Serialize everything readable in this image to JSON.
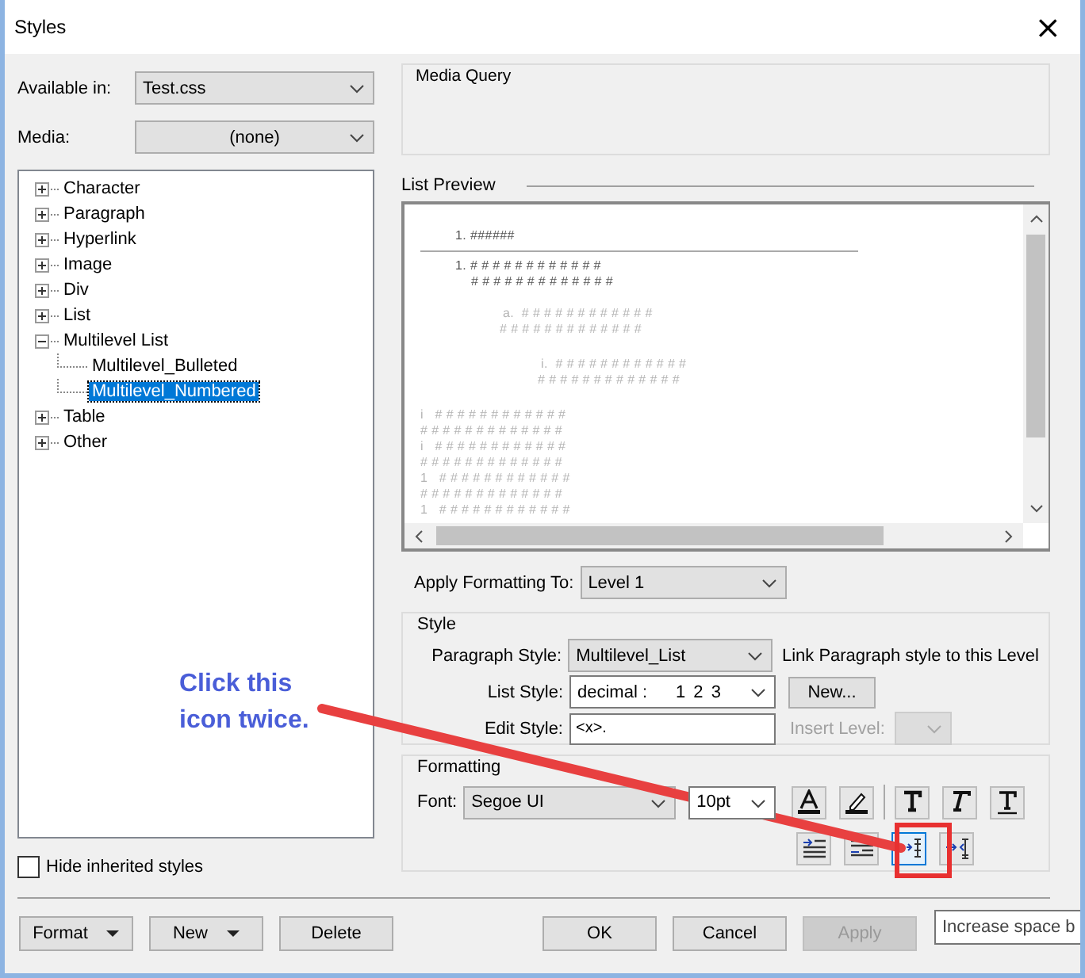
{
  "window": {
    "title": "Styles",
    "close": "×"
  },
  "available_in": {
    "label": "Available in:",
    "value": "Test.css"
  },
  "media": {
    "label": "Media:",
    "value": "(none)"
  },
  "tree": [
    {
      "label": "Character",
      "expanded": false,
      "selected": false
    },
    {
      "label": "Paragraph",
      "expanded": false,
      "selected": false
    },
    {
      "label": "Hyperlink",
      "expanded": false,
      "selected": false
    },
    {
      "label": "Image",
      "expanded": false,
      "selected": false
    },
    {
      "label": "Div",
      "expanded": false,
      "selected": false
    },
    {
      "label": "List",
      "expanded": false,
      "selected": false
    },
    {
      "label": "Multilevel List",
      "expanded": true,
      "selected": false,
      "children": [
        {
          "label": "Multilevel_Bulleted",
          "selected": false
        },
        {
          "label": "Multilevel_Numbered",
          "selected": true
        }
      ]
    },
    {
      "label": "Table",
      "expanded": false,
      "selected": false
    },
    {
      "label": "Other",
      "expanded": false,
      "selected": false
    }
  ],
  "hide_inherited": {
    "label": "Hide inherited styles",
    "checked": false
  },
  "media_query": {
    "label": "Media Query"
  },
  "list_preview": {
    "label": "List Preview",
    "sample": "1. ######",
    "lines": [
      {
        "kind": "level1",
        "text": "1. # # # # # # # # # # # #"
      },
      {
        "kind": "level1-wrap",
        "text": "# # # # # # # # # # # # #"
      },
      {
        "kind": "level2",
        "text": "a.  # # # # # # # # # # # #"
      },
      {
        "kind": "level2-wrap",
        "text": "# # # # # # # # # # # # #"
      },
      {
        "kind": "level3",
        "text": "i.  # # # # # # # # # # # #"
      },
      {
        "kind": "level3-wrap",
        "text": "# # # # # # # # # # # # #"
      },
      {
        "kind": "flat",
        "text": "i   # # # # # # # # # # # #"
      },
      {
        "kind": "flat",
        "text": "# # # # # # # # # # # # #"
      },
      {
        "kind": "flat",
        "text": "i   # # # # # # # # # # # #"
      },
      {
        "kind": "flat",
        "text": "# # # # # # # # # # # # #"
      },
      {
        "kind": "flat",
        "text": "1   # # # # # # # # # # # #"
      },
      {
        "kind": "flat",
        "text": "# # # # # # # # # # # # #"
      },
      {
        "kind": "flat",
        "text": "1   # # # # # # # # # # # #"
      }
    ]
  },
  "apply_formatting_to": {
    "label": "Apply Formatting To:",
    "value": "Level 1"
  },
  "style_group": {
    "label": "Style",
    "paragraph_style": {
      "label": "Paragraph Style:",
      "value": "Multilevel_List"
    },
    "link_text": "Link Paragraph style to this Level",
    "list_style": {
      "label": "List Style:",
      "value": "decimal :",
      "example": "1 2 3"
    },
    "new_button": "New...",
    "edit_style": {
      "label": "Edit Style:",
      "value": "<x>."
    },
    "insert_level": {
      "label": "Insert Level:",
      "disabled": true
    }
  },
  "formatting_group": {
    "label": "Formatting",
    "font": {
      "label": "Font:",
      "value": "Segoe UI"
    },
    "size": {
      "value": "10pt"
    },
    "tools": [
      {
        "kind": "font-color",
        "hover": false
      },
      {
        "kind": "highlight",
        "hover": false
      },
      {
        "kind": "bold",
        "hover": false
      },
      {
        "kind": "italic",
        "hover": false
      },
      {
        "kind": "underline",
        "hover": false
      }
    ],
    "spacing_tools": [
      {
        "kind": "outdent",
        "hover": false
      },
      {
        "kind": "indent",
        "hover": false
      },
      {
        "kind": "increase-space",
        "hover": true
      },
      {
        "kind": "decrease-space",
        "hover": false
      }
    ]
  },
  "left_buttons": [
    {
      "label": "Format",
      "menu": true
    },
    {
      "label": "New",
      "menu": true
    },
    {
      "label": "Delete",
      "menu": false
    }
  ],
  "right_buttons": [
    {
      "label": "OK",
      "disabled": false
    },
    {
      "label": "Cancel",
      "disabled": false
    },
    {
      "label": "Apply",
      "disabled": true
    }
  ],
  "tooltip": "Increase space b",
  "annotation": {
    "text": "Click this icon twice."
  }
}
